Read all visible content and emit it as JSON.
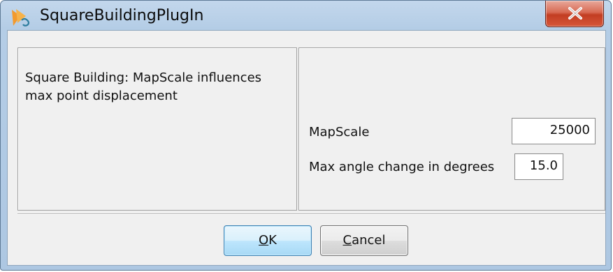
{
  "window": {
    "title": "SquareBuildingPlugIn",
    "close_glyph": "x"
  },
  "description": {
    "text": "Square Building: MapScale influences\nmax point displacement"
  },
  "fields": [
    {
      "label": "MapScale",
      "value": "25000"
    },
    {
      "label": "Max angle change in degrees",
      "value": "15.0"
    }
  ],
  "buttons": {
    "ok": {
      "mnemonic": "O",
      "rest": "K"
    },
    "cancel": {
      "mnemonic": "C",
      "rest": "ancel"
    }
  },
  "icons": {
    "app": "app-logo-icon",
    "close": "close-icon"
  },
  "colors": {
    "titlebar": "#b4cde6",
    "client_bg": "#f0f0f0",
    "close_button": "#c23d22",
    "ok_border": "#3c7fb1"
  }
}
